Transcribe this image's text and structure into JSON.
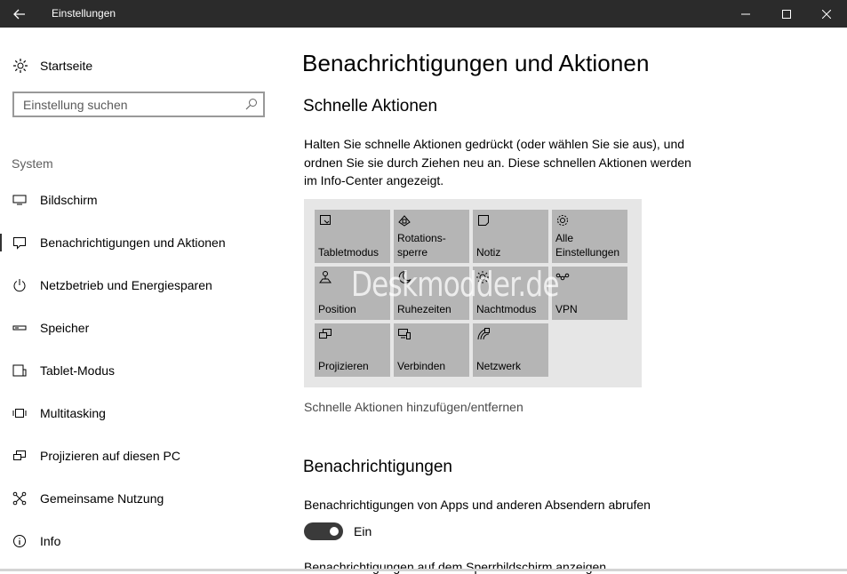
{
  "window": {
    "title": "Einstellungen"
  },
  "sidebar": {
    "home_label": "Startseite",
    "search_placeholder": "Einstellung suchen",
    "section_label": "System",
    "items": [
      {
        "label": "Bildschirm",
        "icon": "monitor-icon"
      },
      {
        "label": "Benachrichtigungen und Aktionen",
        "icon": "notification-icon",
        "selected": true
      },
      {
        "label": "Netzbetrieb und Energiesparen",
        "icon": "power-icon"
      },
      {
        "label": "Speicher",
        "icon": "storage-icon"
      },
      {
        "label": "Tablet-Modus",
        "icon": "tablet-icon"
      },
      {
        "label": "Multitasking",
        "icon": "multitasking-icon"
      },
      {
        "label": "Projizieren auf diesen PC",
        "icon": "project-icon"
      },
      {
        "label": "Gemeinsame Nutzung",
        "icon": "share-icon"
      },
      {
        "label": "Info",
        "icon": "info-icon"
      }
    ]
  },
  "main": {
    "title": "Benachrichtigungen und Aktionen",
    "quick_actions": {
      "heading": "Schnelle Aktionen",
      "description": "Halten Sie schnelle Aktionen gedrückt (oder wählen Sie sie aus), und ordnen Sie sie durch Ziehen neu an. Diese schnellen Aktionen werden im Info-Center angezeigt.",
      "tiles": [
        {
          "line1": "",
          "line2": "Tabletmodus",
          "icon": "tablet-mode-icon"
        },
        {
          "line1": "Rotations-",
          "line2": "sperre",
          "icon": "rotation-lock-icon"
        },
        {
          "line1": "",
          "line2": "Notiz",
          "icon": "note-icon"
        },
        {
          "line1": "Alle",
          "line2": "Einstellungen",
          "icon": "gear-icon"
        },
        {
          "line1": "",
          "line2": "Position",
          "icon": "location-icon"
        },
        {
          "line1": "",
          "line2": "Ruhezeiten",
          "icon": "moon-icon"
        },
        {
          "line1": "",
          "line2": "Nachtmodus",
          "icon": "brightness-icon"
        },
        {
          "line1": "",
          "line2": "VPN",
          "icon": "vpn-icon"
        },
        {
          "line1": "",
          "line2": "Projizieren",
          "icon": "project-icon"
        },
        {
          "line1": "",
          "line2": "Verbinden",
          "icon": "connect-icon"
        },
        {
          "line1": "",
          "line2": "Netzwerk",
          "icon": "network-icon"
        }
      ],
      "watermark": "Deskmodder.de",
      "link": "Schnelle Aktionen hinzufügen/entfernen"
    },
    "notifications": {
      "heading": "Benachrichtigungen",
      "setting1_label": "Benachrichtigungen von Apps und anderen Absendern abrufen",
      "setting1_state": "Ein",
      "setting2_label": "Benachrichtigungen auf dem Sperrbildschirm anzeigen"
    }
  },
  "colors": {
    "titlebar": "#2b2b2b",
    "tile": "#b5b5b5",
    "panel": "#e6e6e6",
    "toggle_on": "#3a3a3a"
  }
}
